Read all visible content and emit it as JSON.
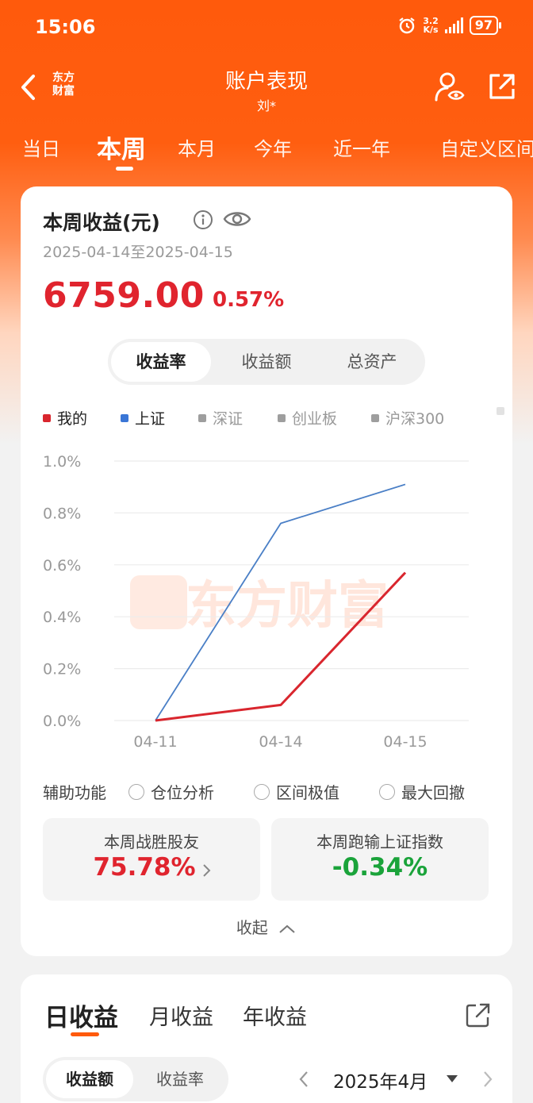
{
  "status_bar": {
    "time": "15:06",
    "net_speed_value": "3.2",
    "net_speed_unit": "K/s",
    "battery": "97"
  },
  "header": {
    "logo_line1": "东方",
    "logo_line2": "财富",
    "title": "账户表现",
    "subtitle": "刘*"
  },
  "period_tabs": [
    {
      "label": "当日"
    },
    {
      "label": "本周"
    },
    {
      "label": "本月"
    },
    {
      "label": "今年"
    },
    {
      "label": "近一年"
    },
    {
      "label": "自定义区间"
    }
  ],
  "summary": {
    "title": "本周收益(元)",
    "date_range": "2025-04-14至2025-04-15",
    "amount": "6759.00",
    "percent": "0.57%"
  },
  "metric_tabs": [
    {
      "label": "收益率"
    },
    {
      "label": "收益额"
    },
    {
      "label": "总资产"
    }
  ],
  "legend": [
    {
      "label": "我的",
      "color": "#d9262e"
    },
    {
      "label": "上证",
      "color": "#3a76d6"
    },
    {
      "label": "深证",
      "color": "#9e9e9e"
    },
    {
      "label": "创业板",
      "color": "#9e9e9e"
    },
    {
      "label": "沪深300",
      "color": "#9e9e9e"
    }
  ],
  "chart_data": {
    "type": "line",
    "x": [
      "04-11",
      "04-14",
      "04-15"
    ],
    "y_ticks": [
      "0.0%",
      "0.2%",
      "0.4%",
      "0.6%",
      "0.8%",
      "1.0%"
    ],
    "ylim": [
      0,
      1.0
    ],
    "series": [
      {
        "name": "我的",
        "values": [
          0.0,
          0.06,
          0.57
        ],
        "color": "#d9262e"
      },
      {
        "name": "上证",
        "values": [
          0.0,
          0.76,
          0.91
        ],
        "color": "#4a7fc6"
      }
    ],
    "grid": true,
    "watermark": "东方财富"
  },
  "aux": {
    "label": "辅助功能",
    "options": [
      {
        "label": "仓位分析"
      },
      {
        "label": "区间极值"
      },
      {
        "label": "最大回撤"
      }
    ]
  },
  "stats": [
    {
      "label": "本周战胜股友",
      "value": "75.78%",
      "color": "#e0242e"
    },
    {
      "label": "本周跑输上证指数",
      "value": "-0.34%",
      "color": "#1aa33a"
    }
  ],
  "collapse_label": "收起",
  "daily": {
    "tabs": [
      {
        "label": "日收益"
      },
      {
        "label": "月收益"
      },
      {
        "label": "年收益"
      }
    ],
    "segment": [
      {
        "label": "收益额"
      },
      {
        "label": "收益率"
      }
    ],
    "month": "2025年4月"
  }
}
